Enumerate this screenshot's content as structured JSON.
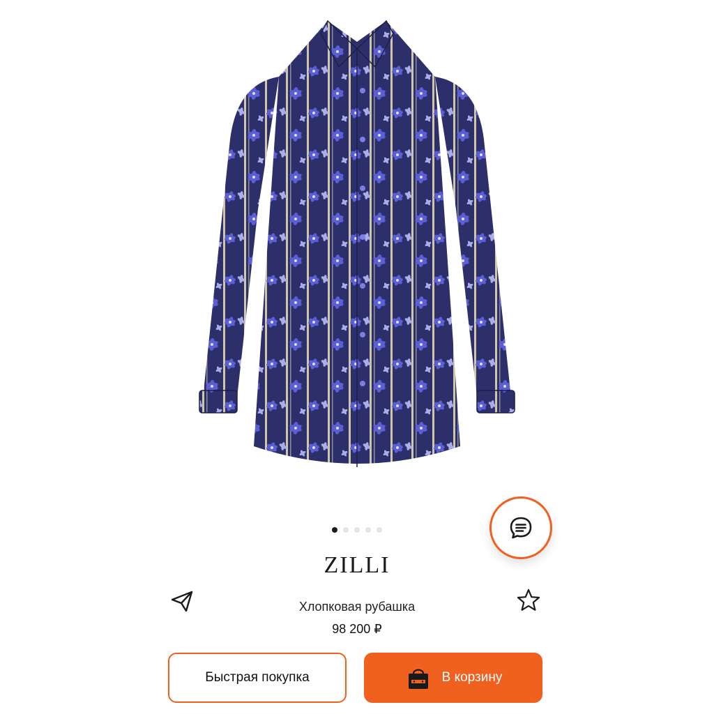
{
  "product": {
    "brand": "ZILLI",
    "name": "Хлопковая рубашка",
    "price": "98 200 ₽",
    "image_alt": "shirt-image"
  },
  "carousel": {
    "total": 5,
    "active_index": 0
  },
  "actions": {
    "quick_buy_label": "Быстрая покупка",
    "cart_label": "В корзину"
  },
  "icons": {
    "share": "share-icon",
    "favorite": "star-icon",
    "chat": "chat-icon",
    "bag": "shopping-bag-icon"
  },
  "colors": {
    "accent": "#f0601e",
    "shirt_base": "#2d2f6b",
    "shirt_flower": "#5b5fd6"
  }
}
